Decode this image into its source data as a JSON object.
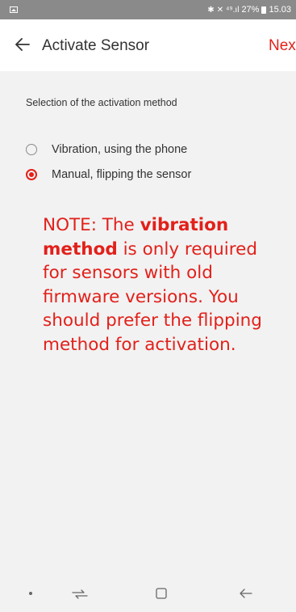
{
  "status_bar": {
    "left_icon": "image-icon",
    "icons": [
      "bluetooth-icon",
      "mute-icon",
      "signal-icon"
    ],
    "battery_percent": "27%",
    "time": "15.03"
  },
  "app_bar": {
    "back_icon": "arrow-left-icon",
    "title": "Activate Sensor",
    "next_label": "Next"
  },
  "content": {
    "section_label": "Selection of the activation method",
    "options": [
      {
        "label": "Vibration, using the phone",
        "selected": false
      },
      {
        "label": "Manual, flipping the sensor",
        "selected": true
      }
    ]
  },
  "note": {
    "prefix": "NOTE: The ",
    "bold": "vibration method",
    "suffix": " is only required for sensors with old firmware versions. You should prefer the flipping method for activation."
  },
  "nav_bar": {
    "icons": [
      "dot-icon",
      "recent-apps-icon",
      "home-icon",
      "back-icon"
    ]
  },
  "colors": {
    "accent": "#e2201a",
    "status_bar": "#8a8a8a",
    "background": "#f2f2f2"
  }
}
